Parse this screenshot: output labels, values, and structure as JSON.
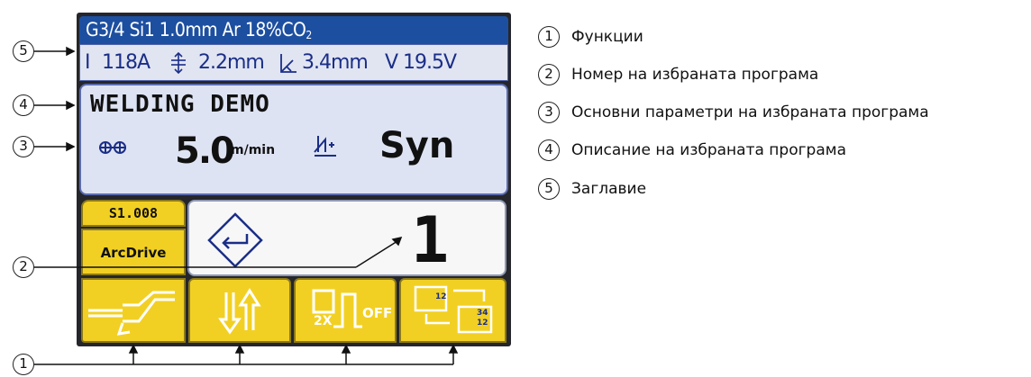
{
  "header": {
    "prefix": "G3/4 Si1 1.0mm Ar 18%CO",
    "sub": "2"
  },
  "params": {
    "current_symbol": "I",
    "current": "118A",
    "thickness": "2.2mm",
    "throat": "3.4mm",
    "voltage_symbol": "V",
    "voltage": "19.5V"
  },
  "description": {
    "title": "WELDING DEMO",
    "wire_speed": "5.0",
    "wire_speed_unit": "m/min",
    "mode": "Syn"
  },
  "program": {
    "code": "S1.008",
    "process": "ArcDrive",
    "number": "1"
  },
  "function_buttons": [
    {
      "icon": "torch-icon"
    },
    {
      "icon": "up-down-arrows-icon",
      "label": ""
    },
    {
      "icon": "double-pulse-icon",
      "label_2x": "2X",
      "label_off": "OFF"
    },
    {
      "icon": "parameter-switch-icon",
      "val1": "12",
      "val2": "34",
      "val3": "12"
    }
  ],
  "callouts": [
    "5",
    "4",
    "3",
    "2",
    "1"
  ],
  "legend": [
    {
      "num": "1",
      "text": "Функции"
    },
    {
      "num": "2",
      "text": "Номер на избраната програма"
    },
    {
      "num": "3",
      "text": "Основни параметри на избраната програма"
    },
    {
      "num": "4",
      "text": "Описание на избраната програма"
    },
    {
      "num": "5",
      "text": "Заглавие"
    }
  ],
  "colors": {
    "header_bg": "#1d4fa0",
    "panel_bg": "#dee3f3",
    "yellow": "#f2d023",
    "text_blue": "#1b2e87"
  }
}
